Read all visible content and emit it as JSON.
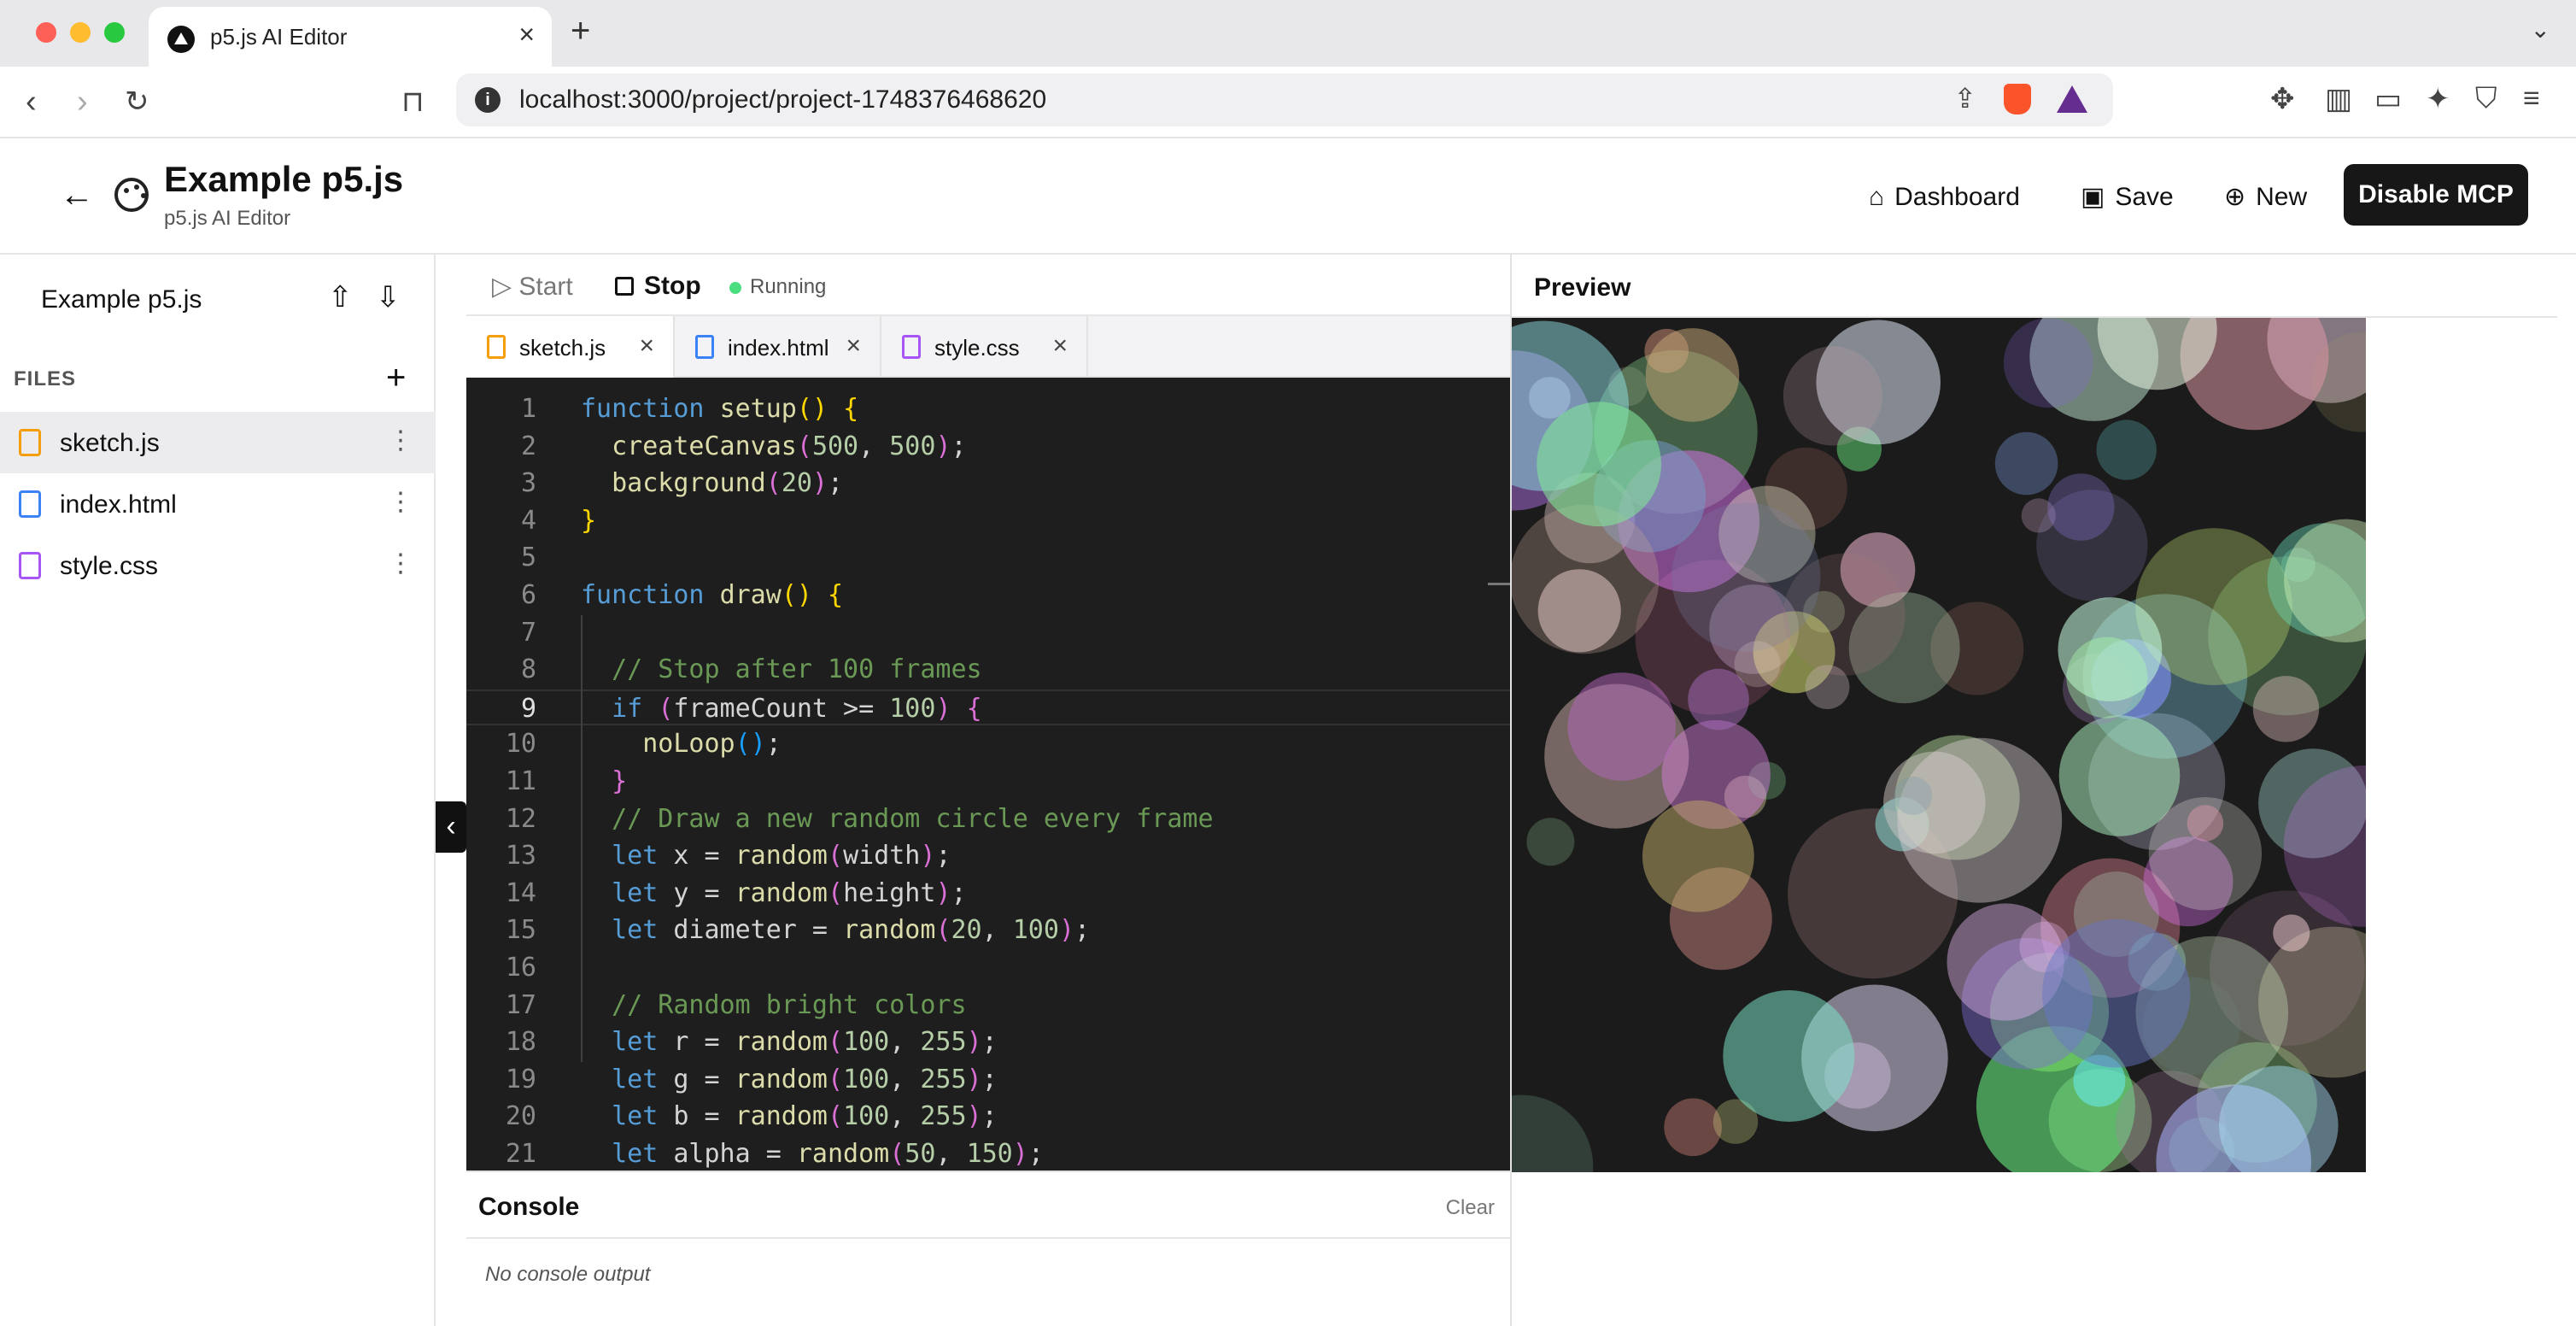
{
  "browser": {
    "tab_title": "p5.js AI Editor",
    "url": "localhost:3000/project/project-1748376468620"
  },
  "header": {
    "title": "Example p5.js",
    "subtitle": "p5.js AI Editor",
    "dashboard_label": "Dashboard",
    "save_label": "Save",
    "new_label": "New",
    "mcp_label": "Disable MCP"
  },
  "sidebar": {
    "project_name": "Example p5.js",
    "files_heading": "FILES",
    "files": [
      {
        "name": "sketch.js",
        "color": "#f59e0b"
      },
      {
        "name": "index.html",
        "color": "#3b82f6"
      },
      {
        "name": "style.css",
        "color": "#a855f7"
      }
    ]
  },
  "runbar": {
    "start_label": "Start",
    "stop_label": "Stop",
    "status": "Running"
  },
  "tabs": [
    {
      "name": "sketch.js",
      "color": "#f59e0b"
    },
    {
      "name": "index.html",
      "color": "#3b82f6"
    },
    {
      "name": "style.css",
      "color": "#a855f7"
    }
  ],
  "code": [
    "function setup() {",
    "  createCanvas(500, 500);",
    "  background(20);",
    "}",
    "",
    "function draw() {",
    "",
    "  // Stop after 100 frames",
    "  if (frameCount >= 100) {",
    "    noLoop();",
    "  }",
    "  // Draw a new random circle every frame",
    "  let x = random(width);",
    "  let y = random(height);",
    "  let diameter = random(20, 100);",
    "",
    "  // Random bright colors",
    "  let r = random(100, 255);",
    "  let g = random(100, 255);",
    "  let b = random(100, 255);",
    "  let alpha = random(50, 150);"
  ],
  "current_line": 9,
  "console": {
    "title": "Console",
    "clear_label": "Clear",
    "empty_text": "No console output"
  },
  "preview": {
    "title": "Preview",
    "canvas_background": "#1b1b1b",
    "circle_count": 100
  }
}
